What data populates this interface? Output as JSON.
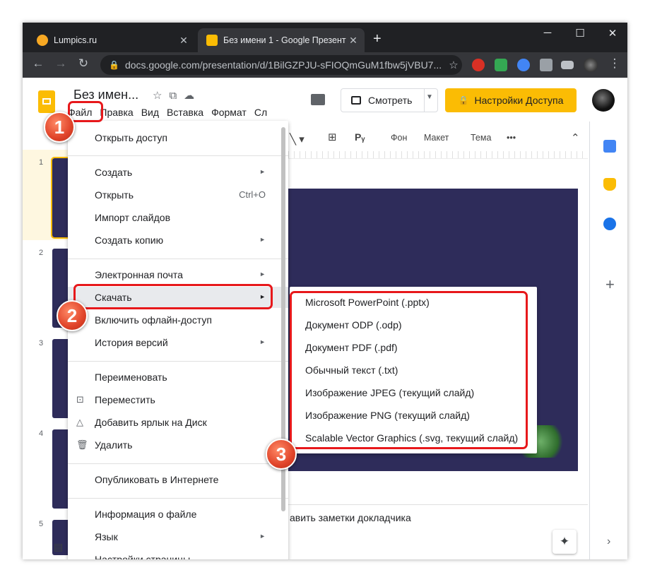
{
  "browser": {
    "tabs": [
      {
        "title": "Lumpics.ru",
        "close": "✕"
      },
      {
        "title": "Без имени 1 - Google Презента",
        "close": "✕"
      }
    ],
    "new_tab": "+",
    "window_controls": {
      "minimize": "─",
      "maximize": "☐",
      "close": "✕"
    },
    "nav": {
      "back": "←",
      "forward": "→",
      "reload": "↻"
    },
    "url": "docs.google.com/presentation/d/1BilGZPJU-sFIOQmGuM1fbw5jVBU7...",
    "bookmark_star": "☆",
    "menu": "⋮"
  },
  "docs": {
    "title": "Без имен...",
    "menu": [
      "Файл",
      "Правка",
      "Вид",
      "Вставка",
      "Формат",
      "Сл"
    ],
    "present_label": "Смотреть",
    "share_label": "Настройки Доступа",
    "share_icon": "🔒"
  },
  "toolbar": {
    "bg_label": "Фон",
    "layout_label": "Макет",
    "theme_label": "Тема",
    "more": "•••",
    "collapse": "⌃",
    "textbox": "Pᵧ",
    "comment": "⊞"
  },
  "filmstrip": {
    "numbers": [
      "1",
      "2",
      "3",
      "4",
      "5"
    ]
  },
  "notes_text": "авить заметки докладчика",
  "file_menu": {
    "items": [
      {
        "label": "Открыть доступ",
        "shortcut": "",
        "arrow": "",
        "icon": ""
      },
      {
        "label": "Создать",
        "shortcut": "",
        "arrow": "►",
        "icon": ""
      },
      {
        "label": "Открыть",
        "shortcut": "Ctrl+O",
        "arrow": "",
        "icon": ""
      },
      {
        "label": "Импорт слайдов",
        "shortcut": "",
        "arrow": "",
        "icon": ""
      },
      {
        "label": "Создать копию",
        "shortcut": "",
        "arrow": "►",
        "icon": ""
      },
      {
        "label": "Электронная почта",
        "shortcut": "",
        "arrow": "►",
        "icon": ""
      },
      {
        "label": "Скачать",
        "shortcut": "",
        "arrow": "►",
        "icon": ""
      },
      {
        "label": "Включить офлайн-доступ",
        "shortcut": "",
        "arrow": "",
        "icon": ""
      },
      {
        "label": "История версий",
        "shortcut": "",
        "arrow": "►",
        "icon": ""
      },
      {
        "label": "Переименовать",
        "shortcut": "",
        "arrow": "",
        "icon": ""
      },
      {
        "label": "Переместить",
        "shortcut": "",
        "arrow": "",
        "icon": "folder-move-icon"
      },
      {
        "label": "Добавить ярлык на Диск",
        "shortcut": "",
        "arrow": "",
        "icon": "drive-shortcut-icon"
      },
      {
        "label": "Удалить",
        "shortcut": "",
        "arrow": "",
        "icon": "trash-icon"
      },
      {
        "label": "Опубликовать в Интернете",
        "shortcut": "",
        "arrow": "",
        "icon": ""
      },
      {
        "label": "Информация о файле",
        "shortcut": "",
        "arrow": "",
        "icon": ""
      },
      {
        "label": "Язык",
        "shortcut": "",
        "arrow": "►",
        "icon": ""
      },
      {
        "label": "Настройки страницы",
        "shortcut": "",
        "arrow": "",
        "icon": ""
      }
    ]
  },
  "download_menu": {
    "items": [
      "Microsoft PowerPoint (.pptx)",
      "Документ ODP (.odp)",
      "Документ PDF (.pdf)",
      "Обычный текст (.txt)",
      "Изображение JPEG (текущий слайд)",
      "Изображение PNG (текущий слайд)",
      "Scalable Vector Graphics (.svg, текущий слайд)"
    ]
  },
  "callouts": [
    "1",
    "2",
    "3"
  ],
  "colors": {
    "accent_yellow": "#fbbc04",
    "callout_red": "#e7181b",
    "slide_bg": "#2e2c5a"
  }
}
